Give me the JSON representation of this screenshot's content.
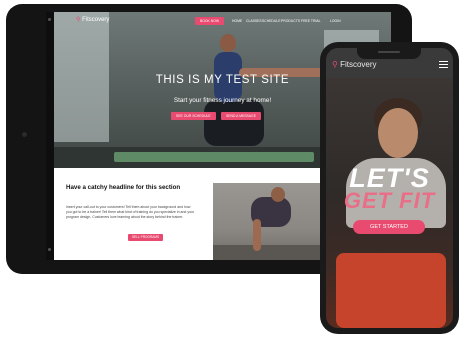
{
  "brand": {
    "name": "Fitscovery",
    "tablet_logo_text": "Fitscovery",
    "phone_logo_text": "Fitscovery",
    "accent_color": "#e94a6f"
  },
  "tablet": {
    "nav": {
      "cta_label": "BOOK NOW",
      "items": [
        "HOME",
        "CLASSES",
        "SCHEDULE",
        "PRODUCTS",
        "FREE TRIAL",
        "LOGIN"
      ]
    },
    "hero": {
      "title": "THIS IS MY TEST SITE",
      "subtitle": "Start your fitness journey at home!",
      "button_left": "SEE OUR SCHEDULE",
      "button_right": "SEND A MESSAGE"
    },
    "section": {
      "headline": "Have a catchy headline for this section",
      "body": "Insert your call-out to your customers! Tell them about your background and how you got to be a trainer! Tell them what kind of training do you specialize in and your program design. Customers love learning about the story behind the trainer.",
      "cta_label": "SELL PROGRAMS"
    }
  },
  "phone": {
    "hero": {
      "line1": "LET'S",
      "line2": "GET FIT",
      "cta_label": "GET STARTED"
    },
    "menu_icon": "hamburger-menu-icon"
  }
}
